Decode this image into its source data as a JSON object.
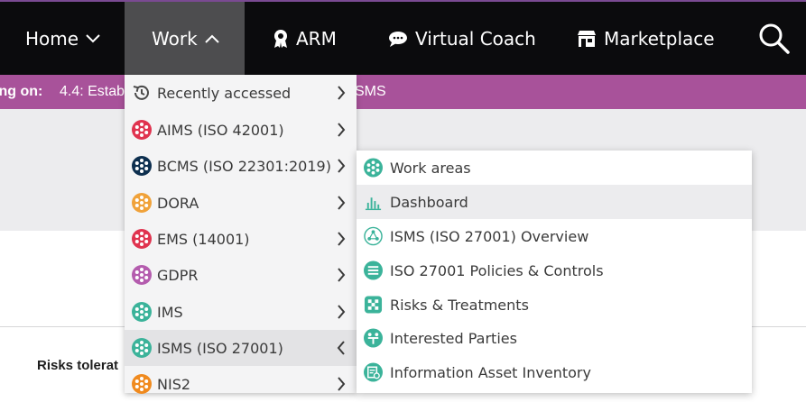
{
  "nav": {
    "home": "Home",
    "work": "Work",
    "arm": "ARM",
    "coach": "Virtual Coach",
    "marketplace": "Marketplace"
  },
  "working": {
    "label": "ing on:",
    "value": "4.4: Estab",
    "tail": "SMS"
  },
  "content": {
    "risks_label": "Risks tolerat"
  },
  "work_menu": {
    "items": [
      {
        "label": "Recently accessed",
        "icon": "history-icon"
      },
      {
        "label": "AIMS (ISO 42001)",
        "icon": "dots-circle-icon",
        "color": "#e0334f"
      },
      {
        "label": "BCMS (ISO 22301:2019)",
        "icon": "dots-circle-icon",
        "color": "#0d2f4f"
      },
      {
        "label": "DORA",
        "icon": "dots-circle-icon",
        "color": "#f0a23a"
      },
      {
        "label": "EMS (14001)",
        "icon": "dots-circle-icon",
        "color": "#e0334f"
      },
      {
        "label": "GDPR",
        "icon": "dots-circle-icon",
        "color": "#b45cae"
      },
      {
        "label": "IMS",
        "icon": "dots-circle-icon",
        "color": "#3bb39a"
      },
      {
        "label": "ISMS (ISO 27001)",
        "icon": "dots-circle-icon",
        "color": "#3bb39a"
      },
      {
        "label": "NIS2",
        "icon": "dots-circle-icon",
        "color": "#f08a1e"
      }
    ]
  },
  "isms_menu": {
    "items": [
      {
        "label": "Work areas",
        "icon": "work-areas-icon"
      },
      {
        "label": "Dashboard",
        "icon": "bar-chart-icon"
      },
      {
        "label": "ISMS (ISO 27001) Overview",
        "icon": "network-icon"
      },
      {
        "label": "ISO 27001 Policies & Controls",
        "icon": "list-icon"
      },
      {
        "label": "Risks & Treatments",
        "icon": "grid-icon"
      },
      {
        "label": "Interested Parties",
        "icon": "people-icon"
      },
      {
        "label": "Information Asset Inventory",
        "icon": "inventory-icon"
      }
    ]
  },
  "colors": {
    "topbar": "#0b0b0d",
    "work_active": "#4d4d4f",
    "working_bar": "#a8529a",
    "teal_icon": "#3bb39a"
  }
}
